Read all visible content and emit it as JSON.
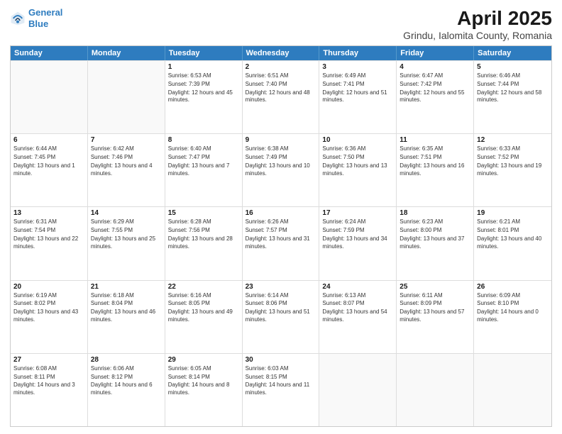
{
  "header": {
    "logo_line1": "General",
    "logo_line2": "Blue",
    "title": "April 2025",
    "subtitle": "Grindu, Ialomita County, Romania"
  },
  "weekdays": [
    "Sunday",
    "Monday",
    "Tuesday",
    "Wednesday",
    "Thursday",
    "Friday",
    "Saturday"
  ],
  "rows": [
    [
      {
        "day": "",
        "sunrise": "",
        "sunset": "",
        "daylight": ""
      },
      {
        "day": "",
        "sunrise": "",
        "sunset": "",
        "daylight": ""
      },
      {
        "day": "1",
        "sunrise": "Sunrise: 6:53 AM",
        "sunset": "Sunset: 7:39 PM",
        "daylight": "Daylight: 12 hours and 45 minutes."
      },
      {
        "day": "2",
        "sunrise": "Sunrise: 6:51 AM",
        "sunset": "Sunset: 7:40 PM",
        "daylight": "Daylight: 12 hours and 48 minutes."
      },
      {
        "day": "3",
        "sunrise": "Sunrise: 6:49 AM",
        "sunset": "Sunset: 7:41 PM",
        "daylight": "Daylight: 12 hours and 51 minutes."
      },
      {
        "day": "4",
        "sunrise": "Sunrise: 6:47 AM",
        "sunset": "Sunset: 7:42 PM",
        "daylight": "Daylight: 12 hours and 55 minutes."
      },
      {
        "day": "5",
        "sunrise": "Sunrise: 6:46 AM",
        "sunset": "Sunset: 7:44 PM",
        "daylight": "Daylight: 12 hours and 58 minutes."
      }
    ],
    [
      {
        "day": "6",
        "sunrise": "Sunrise: 6:44 AM",
        "sunset": "Sunset: 7:45 PM",
        "daylight": "Daylight: 13 hours and 1 minute."
      },
      {
        "day": "7",
        "sunrise": "Sunrise: 6:42 AM",
        "sunset": "Sunset: 7:46 PM",
        "daylight": "Daylight: 13 hours and 4 minutes."
      },
      {
        "day": "8",
        "sunrise": "Sunrise: 6:40 AM",
        "sunset": "Sunset: 7:47 PM",
        "daylight": "Daylight: 13 hours and 7 minutes."
      },
      {
        "day": "9",
        "sunrise": "Sunrise: 6:38 AM",
        "sunset": "Sunset: 7:49 PM",
        "daylight": "Daylight: 13 hours and 10 minutes."
      },
      {
        "day": "10",
        "sunrise": "Sunrise: 6:36 AM",
        "sunset": "Sunset: 7:50 PM",
        "daylight": "Daylight: 13 hours and 13 minutes."
      },
      {
        "day": "11",
        "sunrise": "Sunrise: 6:35 AM",
        "sunset": "Sunset: 7:51 PM",
        "daylight": "Daylight: 13 hours and 16 minutes."
      },
      {
        "day": "12",
        "sunrise": "Sunrise: 6:33 AM",
        "sunset": "Sunset: 7:52 PM",
        "daylight": "Daylight: 13 hours and 19 minutes."
      }
    ],
    [
      {
        "day": "13",
        "sunrise": "Sunrise: 6:31 AM",
        "sunset": "Sunset: 7:54 PM",
        "daylight": "Daylight: 13 hours and 22 minutes."
      },
      {
        "day": "14",
        "sunrise": "Sunrise: 6:29 AM",
        "sunset": "Sunset: 7:55 PM",
        "daylight": "Daylight: 13 hours and 25 minutes."
      },
      {
        "day": "15",
        "sunrise": "Sunrise: 6:28 AM",
        "sunset": "Sunset: 7:56 PM",
        "daylight": "Daylight: 13 hours and 28 minutes."
      },
      {
        "day": "16",
        "sunrise": "Sunrise: 6:26 AM",
        "sunset": "Sunset: 7:57 PM",
        "daylight": "Daylight: 13 hours and 31 minutes."
      },
      {
        "day": "17",
        "sunrise": "Sunrise: 6:24 AM",
        "sunset": "Sunset: 7:59 PM",
        "daylight": "Daylight: 13 hours and 34 minutes."
      },
      {
        "day": "18",
        "sunrise": "Sunrise: 6:23 AM",
        "sunset": "Sunset: 8:00 PM",
        "daylight": "Daylight: 13 hours and 37 minutes."
      },
      {
        "day": "19",
        "sunrise": "Sunrise: 6:21 AM",
        "sunset": "Sunset: 8:01 PM",
        "daylight": "Daylight: 13 hours and 40 minutes."
      }
    ],
    [
      {
        "day": "20",
        "sunrise": "Sunrise: 6:19 AM",
        "sunset": "Sunset: 8:02 PM",
        "daylight": "Daylight: 13 hours and 43 minutes."
      },
      {
        "day": "21",
        "sunrise": "Sunrise: 6:18 AM",
        "sunset": "Sunset: 8:04 PM",
        "daylight": "Daylight: 13 hours and 46 minutes."
      },
      {
        "day": "22",
        "sunrise": "Sunrise: 6:16 AM",
        "sunset": "Sunset: 8:05 PM",
        "daylight": "Daylight: 13 hours and 49 minutes."
      },
      {
        "day": "23",
        "sunrise": "Sunrise: 6:14 AM",
        "sunset": "Sunset: 8:06 PM",
        "daylight": "Daylight: 13 hours and 51 minutes."
      },
      {
        "day": "24",
        "sunrise": "Sunrise: 6:13 AM",
        "sunset": "Sunset: 8:07 PM",
        "daylight": "Daylight: 13 hours and 54 minutes."
      },
      {
        "day": "25",
        "sunrise": "Sunrise: 6:11 AM",
        "sunset": "Sunset: 8:09 PM",
        "daylight": "Daylight: 13 hours and 57 minutes."
      },
      {
        "day": "26",
        "sunrise": "Sunrise: 6:09 AM",
        "sunset": "Sunset: 8:10 PM",
        "daylight": "Daylight: 14 hours and 0 minutes."
      }
    ],
    [
      {
        "day": "27",
        "sunrise": "Sunrise: 6:08 AM",
        "sunset": "Sunset: 8:11 PM",
        "daylight": "Daylight: 14 hours and 3 minutes."
      },
      {
        "day": "28",
        "sunrise": "Sunrise: 6:06 AM",
        "sunset": "Sunset: 8:12 PM",
        "daylight": "Daylight: 14 hours and 6 minutes."
      },
      {
        "day": "29",
        "sunrise": "Sunrise: 6:05 AM",
        "sunset": "Sunset: 8:14 PM",
        "daylight": "Daylight: 14 hours and 8 minutes."
      },
      {
        "day": "30",
        "sunrise": "Sunrise: 6:03 AM",
        "sunset": "Sunset: 8:15 PM",
        "daylight": "Daylight: 14 hours and 11 minutes."
      },
      {
        "day": "",
        "sunrise": "",
        "sunset": "",
        "daylight": ""
      },
      {
        "day": "",
        "sunrise": "",
        "sunset": "",
        "daylight": ""
      },
      {
        "day": "",
        "sunrise": "",
        "sunset": "",
        "daylight": ""
      }
    ]
  ]
}
